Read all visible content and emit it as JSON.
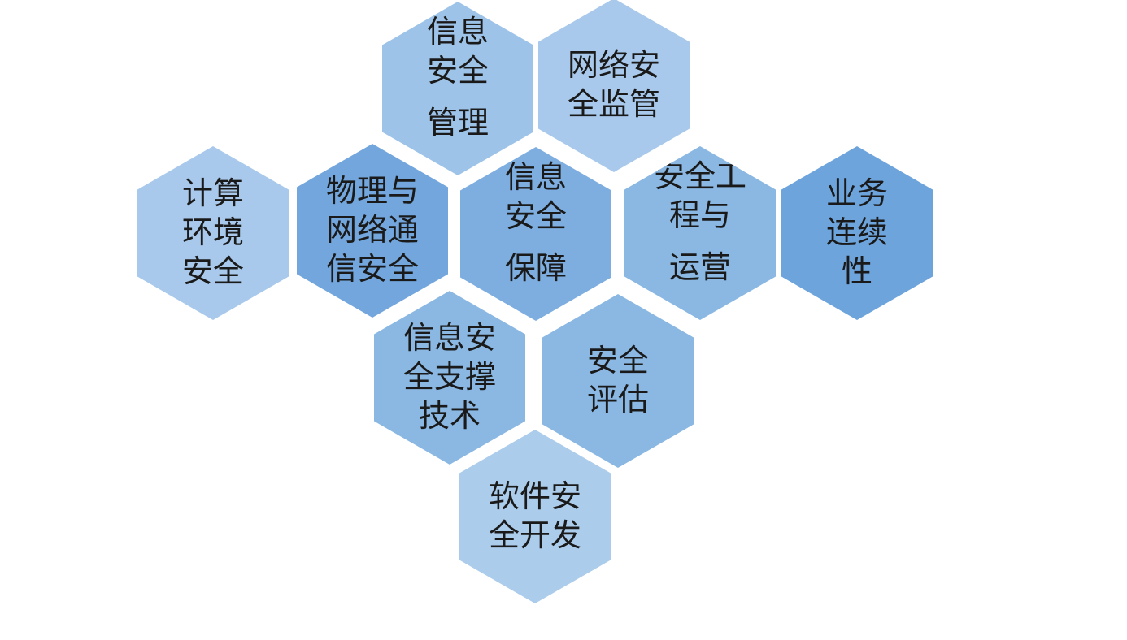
{
  "colors": {
    "light": "#a8c9eb",
    "mid": "#85b3e0",
    "dark": "#6fa5dc",
    "text": "#1a1a1a"
  },
  "hexagons": [
    {
      "id": "info-security-management",
      "name": "信息安全管理",
      "color": "#9dc3e8",
      "lines": [
        "信息",
        "安全"
      ],
      "extra_line": "管理"
    },
    {
      "id": "network-security-supervision",
      "name": "网络安全监管",
      "color": "#a8c9eb",
      "lines": [
        "网络安",
        "全监管"
      ]
    },
    {
      "id": "computing-environment-security",
      "name": "计算环境安全",
      "color": "#a8c9eb",
      "lines": [
        "计算",
        "环境",
        "安全"
      ]
    },
    {
      "id": "physical-network-communication-security",
      "name": "物理与网络通信安全",
      "color": "#72a6dc",
      "lines": [
        "物理与",
        "网络通",
        "信安全"
      ]
    },
    {
      "id": "info-security-assurance",
      "name": "信息安全保障",
      "color": "#7eaee0",
      "lines": [
        "信息",
        "安全"
      ],
      "extra_line": "保障"
    },
    {
      "id": "security-engineering-operations",
      "name": "安全工程与运营",
      "color": "#8ab8e3",
      "lines": [
        "安全工",
        "程与"
      ],
      "extra_line": "运营"
    },
    {
      "id": "business-continuity",
      "name": "业务连续性",
      "color": "#6da4dc",
      "lines": [
        "业务",
        "连续",
        "性"
      ]
    },
    {
      "id": "info-security-support-technology",
      "name": "信息安全支撑技术",
      "color": "#8ab8e3",
      "lines": [
        "信息安",
        "全支撑",
        "技术"
      ]
    },
    {
      "id": "security-assessment",
      "name": "安全评估",
      "color": "#8ab8e3",
      "lines": [
        "安全",
        "评估"
      ]
    },
    {
      "id": "software-security-development",
      "name": "软件安全开发",
      "color": "#acccec",
      "lines": [
        "软件安",
        "全开发"
      ]
    }
  ]
}
